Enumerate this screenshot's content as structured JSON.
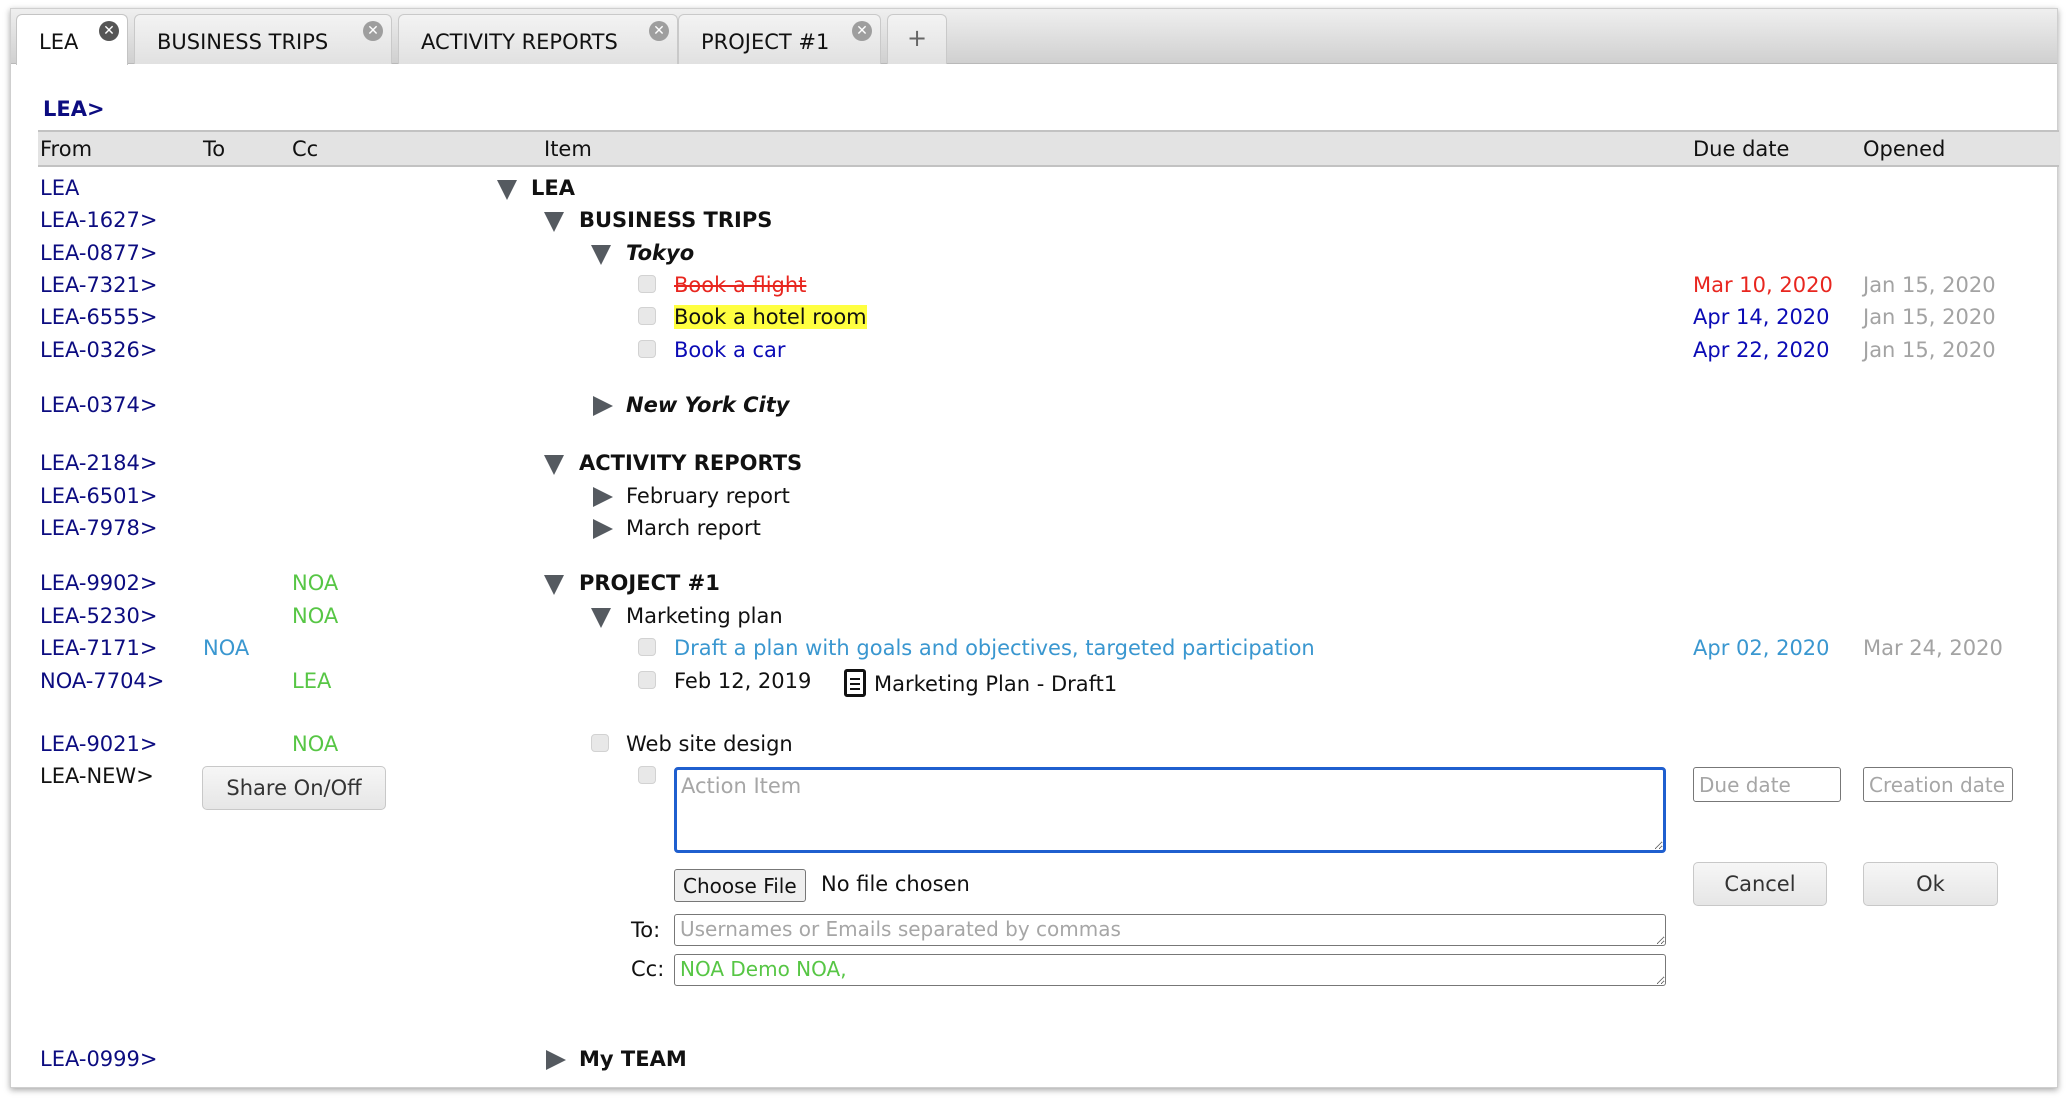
{
  "tabs": [
    {
      "label": "LEA",
      "active": true
    },
    {
      "label": "BUSINESS TRIPS",
      "active": false
    },
    {
      "label": "ACTIVITY REPORTS",
      "active": false
    },
    {
      "label": "PROJECT #1",
      "active": false
    }
  ],
  "add_tab_label": "+",
  "breadcrumb": "LEA>",
  "columns": {
    "from": "From",
    "to": "To",
    "cc": "Cc",
    "item": "Item",
    "due": "Due date",
    "opened": "Opened"
  },
  "rows": [
    {
      "from": "LEA",
      "item": "LEA"
    },
    {
      "from": "LEA-1627>",
      "item": "BUSINESS TRIPS"
    },
    {
      "from": "LEA-0877>",
      "item": "Tokyo"
    },
    {
      "from": "LEA-7321>",
      "item": "Book a flight",
      "due": "Mar 10, 2020",
      "opened": "Jan 15, 2020"
    },
    {
      "from": "LEA-6555>",
      "item": "Book a hotel room",
      "due": "Apr 14, 2020",
      "opened": "Jan 15, 2020"
    },
    {
      "from": "LEA-0326>",
      "item": "Book a car",
      "due": "Apr 22, 2020",
      "opened": "Jan 15, 2020"
    },
    {
      "from": "LEA-0374>",
      "item": "New York City"
    },
    {
      "from": "LEA-2184>",
      "item": "ACTIVITY REPORTS"
    },
    {
      "from": "LEA-6501>",
      "item": "February report"
    },
    {
      "from": "LEA-7978>",
      "item": "March report"
    },
    {
      "from": "LEA-9902>",
      "cc": "NOA",
      "item": "PROJECT #1"
    },
    {
      "from": "LEA-5230>",
      "cc": "NOA",
      "item": "Marketing plan"
    },
    {
      "from": "LEA-7171>",
      "to": "NOA",
      "item": "Draft a plan with goals and objectives, targeted participation",
      "due": "Apr 02, 2020",
      "opened": "Mar 24, 2020"
    },
    {
      "from": "NOA-7704>",
      "cc": "LEA",
      "item_date": "Feb 12, 2019",
      "item": "Marketing Plan - Draft1"
    },
    {
      "from": "LEA-9021>",
      "cc": "NOA",
      "item": "Web site design"
    },
    {
      "from": "LEA-NEW>"
    },
    {
      "from": "LEA-0999>",
      "item": "My TEAM"
    }
  ],
  "new_item_form": {
    "share_button": "Share On/Off",
    "action_item_placeholder": "Action Item",
    "due_date_placeholder": "Due date",
    "creation_date_placeholder": "Creation date",
    "choose_file_label": "Choose File",
    "file_status": "No file chosen",
    "cancel_label": "Cancel",
    "ok_label": "Ok",
    "to_label": "To:",
    "to_placeholder": "Usernames or Emails separated by commas",
    "cc_label": "Cc:",
    "cc_value": "NOA Demo NOA,"
  },
  "colors": {
    "link_navy": "#0c0c80",
    "overdue_red": "#e8261f",
    "due_blue": "#0b0bb5",
    "shared_blue": "#3a97d0",
    "cc_green": "#57c645",
    "highlight_yellow": "#ffff40",
    "focus_blue": "#1f5fcf"
  }
}
